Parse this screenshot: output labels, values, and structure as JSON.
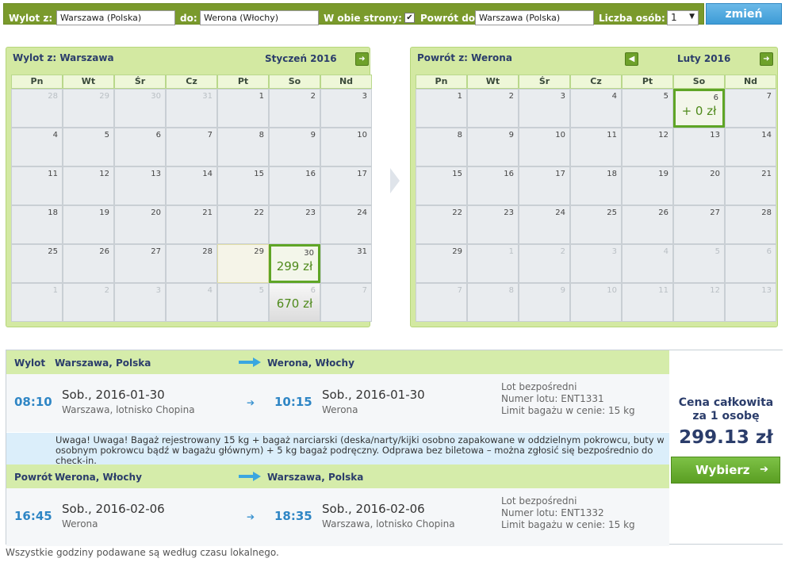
{
  "search": {
    "from_label": "Wylot z:",
    "from_value": "Warszawa (Polska)",
    "to_label": "do:",
    "to_value": "Werona (Włochy)",
    "roundtrip_label": "W obie strony:",
    "roundtrip_checked": "✔",
    "return_label": "Powrót do:",
    "return_value": "Warszawa (Polska)",
    "persons_label": "Liczba osób:",
    "persons_value": "1",
    "submit_label": "zmień"
  },
  "weekdays": [
    "Pn",
    "Wt",
    "Śr",
    "Cz",
    "Pt",
    "So",
    "Nd"
  ],
  "calendars": [
    {
      "title_prefix": "Wylot z:",
      "title_city": "Warszawa",
      "month": "Styczeń 2016",
      "has_prev": false,
      "has_next": true,
      "days": [
        {
          "n": "28",
          "other": true
        },
        {
          "n": "29",
          "other": true
        },
        {
          "n": "30",
          "other": true
        },
        {
          "n": "31",
          "other": true
        },
        {
          "n": "1"
        },
        {
          "n": "2"
        },
        {
          "n": "3"
        },
        {
          "n": "4"
        },
        {
          "n": "5"
        },
        {
          "n": "6"
        },
        {
          "n": "7"
        },
        {
          "n": "8"
        },
        {
          "n": "9"
        },
        {
          "n": "10"
        },
        {
          "n": "11"
        },
        {
          "n": "12"
        },
        {
          "n": "13"
        },
        {
          "n": "14"
        },
        {
          "n": "15"
        },
        {
          "n": "16"
        },
        {
          "n": "17"
        },
        {
          "n": "18"
        },
        {
          "n": "19"
        },
        {
          "n": "20"
        },
        {
          "n": "21"
        },
        {
          "n": "22"
        },
        {
          "n": "23"
        },
        {
          "n": "24"
        },
        {
          "n": "25"
        },
        {
          "n": "26"
        },
        {
          "n": "27"
        },
        {
          "n": "28"
        },
        {
          "n": "29",
          "hover": true
        },
        {
          "n": "30",
          "price": "299 zł",
          "selected": true
        },
        {
          "n": "31"
        },
        {
          "n": "1",
          "other": true
        },
        {
          "n": "2",
          "other": true
        },
        {
          "n": "3",
          "other": true
        },
        {
          "n": "4",
          "other": true
        },
        {
          "n": "5",
          "other": true
        },
        {
          "n": "6",
          "other": true,
          "price": "670 zł"
        },
        {
          "n": "7",
          "other": true
        }
      ]
    },
    {
      "title_prefix": "Powrót z:",
      "title_city": "Werona",
      "month": "Luty 2016",
      "has_prev": true,
      "has_next": true,
      "days": [
        {
          "n": "1"
        },
        {
          "n": "2"
        },
        {
          "n": "3"
        },
        {
          "n": "4"
        },
        {
          "n": "5"
        },
        {
          "n": "6",
          "price": "+ 0 zł",
          "selected": true
        },
        {
          "n": "7"
        },
        {
          "n": "8"
        },
        {
          "n": "9"
        },
        {
          "n": "10"
        },
        {
          "n": "11"
        },
        {
          "n": "12"
        },
        {
          "n": "13"
        },
        {
          "n": "14"
        },
        {
          "n": "15"
        },
        {
          "n": "16"
        },
        {
          "n": "17"
        },
        {
          "n": "18"
        },
        {
          "n": "19"
        },
        {
          "n": "20"
        },
        {
          "n": "21"
        },
        {
          "n": "22"
        },
        {
          "n": "23"
        },
        {
          "n": "24"
        },
        {
          "n": "25"
        },
        {
          "n": "26"
        },
        {
          "n": "27"
        },
        {
          "n": "28"
        },
        {
          "n": "29"
        },
        {
          "n": "1",
          "other": true
        },
        {
          "n": "2",
          "other": true
        },
        {
          "n": "3",
          "other": true
        },
        {
          "n": "4",
          "other": true
        },
        {
          "n": "5",
          "other": true
        },
        {
          "n": "6",
          "other": true
        },
        {
          "n": "7",
          "other": true
        },
        {
          "n": "8",
          "other": true
        },
        {
          "n": "9",
          "other": true
        },
        {
          "n": "10",
          "other": true
        },
        {
          "n": "11",
          "other": true
        },
        {
          "n": "12",
          "other": true
        },
        {
          "n": "13",
          "other": true
        }
      ]
    }
  ],
  "outbound": {
    "label": "Wylot",
    "from_city": "Warszawa, Polska",
    "to_city": "Werona, Włochy",
    "dep_time": "08:10",
    "dep_date": "Sob., 2016-01-30",
    "dep_place": "Warszawa, lotnisko Chopina",
    "arr_time": "10:15",
    "arr_date": "Sob., 2016-01-30",
    "arr_place": "Werona",
    "info_type": "Lot bezpośredni",
    "info_flight": "Numer lotu: ENT1331",
    "info_baggage": "Limit bagażu w cenie: 15 kg"
  },
  "warning": "Uwaga! Uwaga! Bagaż rejestrowany 15 kg + bagaż narciarski (deska/narty/kijki osobno zapakowane w oddzielnym pokrowcu, buty w osobnym pokrowcu bądź w bagażu głównym) + 5 kg bagaż podręczny. Odprawa bez biletowa – można zgłosić się bezpośrednio do check-in.",
  "return": {
    "label": "Powrót",
    "from_city": "Werona, Włochy",
    "to_city": "Warszawa, Polska",
    "dep_time": "16:45",
    "dep_date": "Sob., 2016-02-06",
    "dep_place": "Werona",
    "arr_time": "18:35",
    "arr_date": "Sob., 2016-02-06",
    "arr_place": "Warszawa, lotnisko Chopina",
    "info_type": "Lot bezpośredni",
    "info_flight": "Numer lotu: ENT1332",
    "info_baggage": "Limit bagażu w cenie: 15 kg"
  },
  "price": {
    "label_line1": "Cena całkowita",
    "label_line2": "za 1 osobę",
    "value": "299.13 zł",
    "button": "Wybierz"
  },
  "footnote": "Wszystkie godziny podawane są według czasu lokalnego.",
  "colors": {
    "accent_green": "#5fa526",
    "accent_blue": "#2f86c5",
    "navy": "#2b3d6b"
  }
}
